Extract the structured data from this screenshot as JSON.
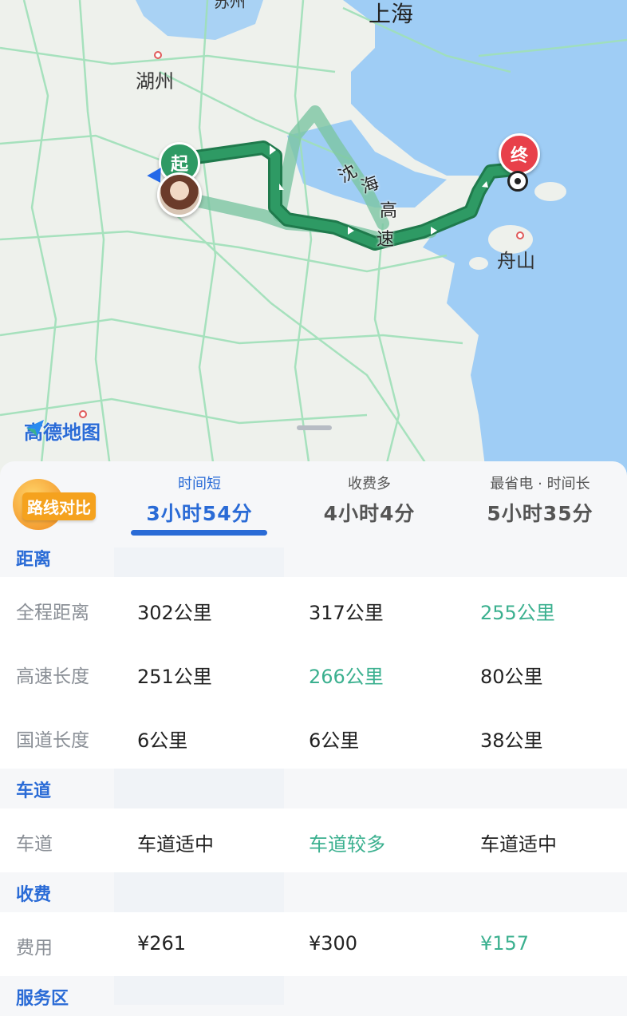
{
  "map": {
    "cities": {
      "shanghai": "上海",
      "huzhou": "湖州",
      "zhoushan": "舟山",
      "suzhou_partial": "苏州"
    },
    "road_label": [
      "沈",
      "海",
      "高",
      "速"
    ],
    "start_label": "起",
    "end_label": "终",
    "brand": "高德地图",
    "colors": {
      "route_main": "#2e9a64",
      "route_alt": "#7cc6a3",
      "sea": "#9fcdf5",
      "land": "#eef1ec"
    }
  },
  "panel": {
    "badge": "路线对比",
    "tabs": [
      {
        "sub": "时间短",
        "duration": "3小时54分",
        "active": true
      },
      {
        "sub": "收费多",
        "duration": "4小时4分",
        "active": false
      },
      {
        "sub": "最省电 · 时间长",
        "duration": "5小时35分",
        "active": false
      }
    ],
    "sections": {
      "distance": {
        "title": "距离",
        "rows": [
          {
            "label": "全程距离",
            "values": [
              "302公里",
              "317公里",
              "255公里"
            ]
          },
          {
            "label": "高速长度",
            "values": [
              "251公里",
              "266公里",
              "80公里"
            ]
          },
          {
            "label": "国道长度",
            "values": [
              "6公里",
              "6公里",
              "38公里"
            ]
          }
        ]
      },
      "lanes": {
        "title": "车道",
        "rows": [
          {
            "label": "车道",
            "values": [
              "车道适中",
              "车道较多",
              "车道适中"
            ]
          }
        ]
      },
      "tolls": {
        "title": "收费",
        "rows": [
          {
            "label": "费用",
            "values": [
              "¥261",
              "¥300",
              "¥157"
            ]
          }
        ]
      },
      "service": {
        "title": "服务区"
      }
    },
    "highlight_color": "#3bb08f",
    "accent_color": "#2a6bd6"
  }
}
